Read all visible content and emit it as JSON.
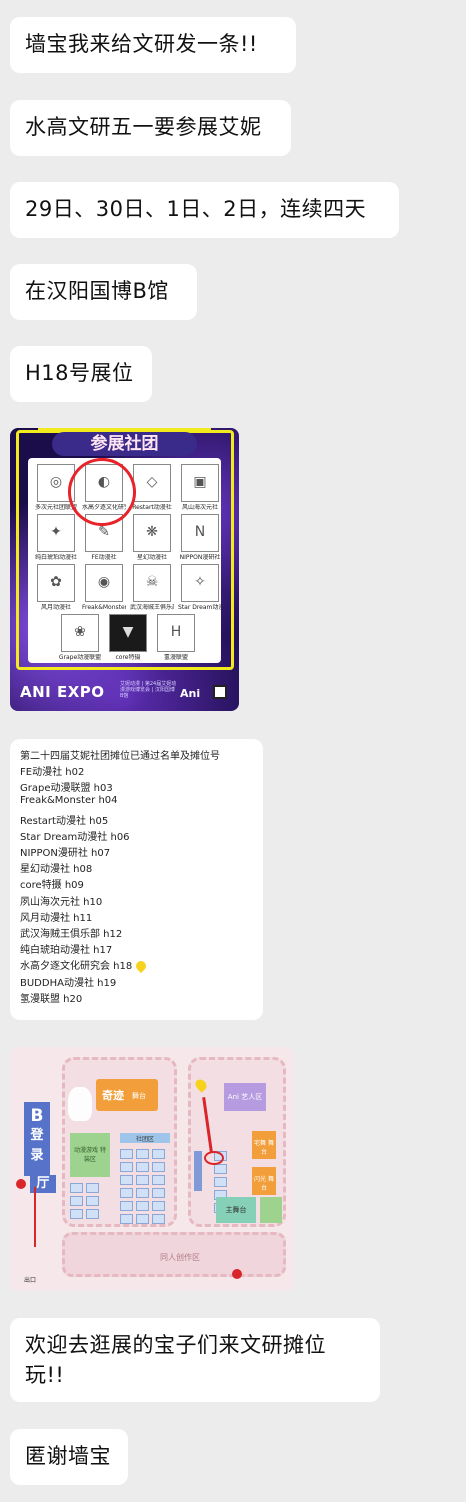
{
  "messages": [
    "墙宝我来给文研发一条!!",
    "水高文研五一要参展艾妮",
    "29日、30日、1日、2日，连续四天",
    "在汉阳国博B馆",
    "H18号展位"
  ],
  "poster": {
    "banner": "参展社团",
    "logos": [
      {
        "name": "多次元社团联盟",
        "sym": "◎"
      },
      {
        "name": "水高夕逐文化研究会",
        "sym": "◐"
      },
      {
        "name": "Restart动漫社",
        "sym": "◇"
      },
      {
        "name": "风山海次元社",
        "sym": "▣"
      },
      {
        "name": "纯白琥珀动漫社",
        "sym": "✦"
      },
      {
        "name": "FE动漫社",
        "sym": "✎"
      },
      {
        "name": "星幻动漫社",
        "sym": "❋"
      },
      {
        "name": "NIPPON漫研社",
        "sym": "N"
      },
      {
        "name": "风月动漫社",
        "sym": "✿"
      },
      {
        "name": "Freak&Monster",
        "sym": "◉"
      },
      {
        "name": "武汉海贼王俱乐部",
        "sym": "☠"
      },
      {
        "name": "Star Dream动漫社",
        "sym": "✧"
      },
      {
        "name": "Grape动漫联盟",
        "sym": "❀"
      },
      {
        "name": "core特摄",
        "sym": "▼"
      },
      {
        "name": "氢漫联盟",
        "sym": "H"
      }
    ],
    "footer_brand": "ANI EXPO",
    "footer_small": "艾妮动漫 | 第24届艾妮动漫游戏博览会 | 汉阳国博B馆",
    "footer_logo": "Ani"
  },
  "list": {
    "title": "第二十四届艾妮社团摊位已通过名单及摊位号",
    "rows": [
      "FE动漫社 h02",
      "Grape动漫联盟 h03",
      "Freak&Monster h04",
      "Restart动漫社 h05",
      "Star Dream动漫社 h06",
      "NIPPON漫研社 h07",
      "星幻动漫社 h08",
      "core特摄 h09",
      "夙山海次元社 h10",
      "风月动漫社 h11",
      "武汉海贼王俱乐部 h12",
      "纯白琥珀动漫社 h17",
      "水高夕逐文化研究会 h18",
      "BUDDHA动漫社 h19",
      "氢漫联盟 h20"
    ],
    "highlight_index": 12
  },
  "map": {
    "hall_label": "B登录厅",
    "hall_letter": "B",
    "hall_chars": [
      "登",
      "录",
      "厅"
    ],
    "zone_miracle": "奇迹",
    "zone_miracle_sub": "舞台",
    "zone_green": "动漫游戏 特装区",
    "zone_blue": "社团区",
    "zone_right_top": "Ani 艺人区",
    "zone_stage": "主舞台",
    "zone_orange_a": "宅舞 舞台",
    "zone_orange_b": "闪光 舞台",
    "zone_bottom": "同人创作区",
    "exit_label": "出口"
  },
  "closing": [
    "欢迎去逛展的宝子们来文研摊位玩!!",
    "匿谢墙宝"
  ]
}
